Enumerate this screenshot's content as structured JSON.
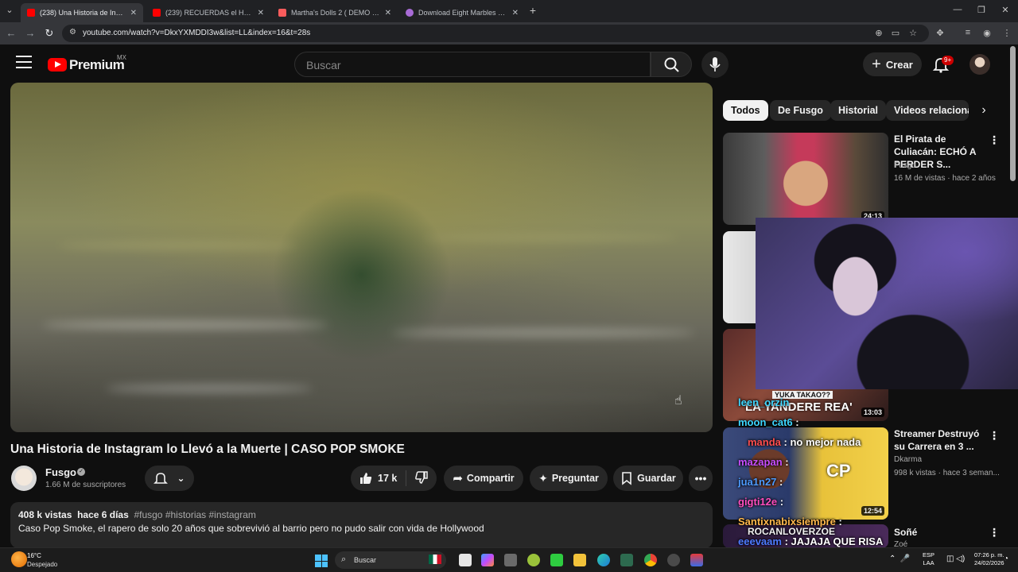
{
  "browser": {
    "tabs": [
      {
        "label": "(238) Una Historia de Instagram",
        "active": true,
        "favicon_color": "#ff0000"
      },
      {
        "label": "(239) RECUERDAS el HERMANO",
        "active": false,
        "favicon_color": "#ff0000"
      },
      {
        "label": "Martha's Dolls 2 ( DEMO ) by A",
        "active": false,
        "favicon_color": "#fa5c5c"
      },
      {
        "label": "Download Eight Marbles MEGA",
        "active": false,
        "favicon_color": "#a86bd6"
      }
    ],
    "new_tab": "+",
    "url": "youtube.com/watch?v=DkxYXMDDI3w&list=LL&index=16&t=28s"
  },
  "header": {
    "brand": "Premium",
    "country": "MX",
    "search_placeholder": "Buscar",
    "create_label": "Crear",
    "notifications_badge": "9+"
  },
  "video": {
    "title": "Una Historia de Instagram lo Llevó a la Muerte | CASO POP SMOKE",
    "channel": "Fusgo",
    "subscribers": "1.66 M de suscriptores",
    "likes": "17 k",
    "share_label": "Compartir",
    "ask_label": "Preguntar",
    "save_label": "Guardar",
    "more_label": "•••",
    "views": "408 k vistas",
    "date": "hace 6 días",
    "hashtags": "#fusgo #historias #instagram",
    "description": "Caso Pop Smoke, el rapero de solo 20 años que sobrevivió al barrio pero no pudo salir con vida de Hollywood"
  },
  "sidebar": {
    "chips": [
      "Todos",
      "De Fusgo",
      "Historial",
      "Videos relaciona"
    ],
    "recommendations": [
      {
        "title": "El Pirata de Culiacán: ECHÓ A PERDER S...",
        "channel": "Fusgo",
        "meta": "16 M de vistas · hace 2 años",
        "duration": "24:13"
      },
      {
        "title": "",
        "channel": "",
        "meta": "",
        "duration": ""
      },
      {
        "title": "",
        "channel": "",
        "meta": "",
        "duration": "13:03"
      },
      {
        "title": "Streamer Destruyó su Carrera en 3 ...",
        "channel": "Dkarma",
        "meta": "998 k vistas · hace 3 seman...",
        "duration": "12:54"
      },
      {
        "title": "Soñé",
        "channel": "Zoé",
        "meta": "",
        "duration": ""
      }
    ]
  },
  "chat": [
    {
      "user": "leen_orzin",
      "msg": ""
    },
    {
      "user": "moon_cat6",
      "msg": ":"
    },
    {
      "user": "manda",
      "msg": ": no mejor nada"
    },
    {
      "user": "mazapan",
      "msg": ":"
    },
    {
      "user": "jua1n27",
      "msg": ":"
    },
    {
      "user": "gigti12e",
      "msg": ":"
    },
    {
      "user": "Santixnabixsiempre",
      "msg": ":"
    },
    {
      "user": "eeevaam",
      "msg": ": JAJAJA QUE RISA"
    }
  ],
  "overlay_text": {
    "thumb_banner": "LA YANDERE REA'",
    "thumb_small": "YUKA TAKAO??",
    "thumb_name": "ROCANLOVERZOE"
  },
  "taskbar": {
    "temperature": "16°C",
    "weather": "Despejado",
    "search_label": "Buscar",
    "lang_top": "ESP",
    "lang_bottom": "LAA",
    "time": "07:26 p. m.",
    "date": "24/02/2026"
  }
}
